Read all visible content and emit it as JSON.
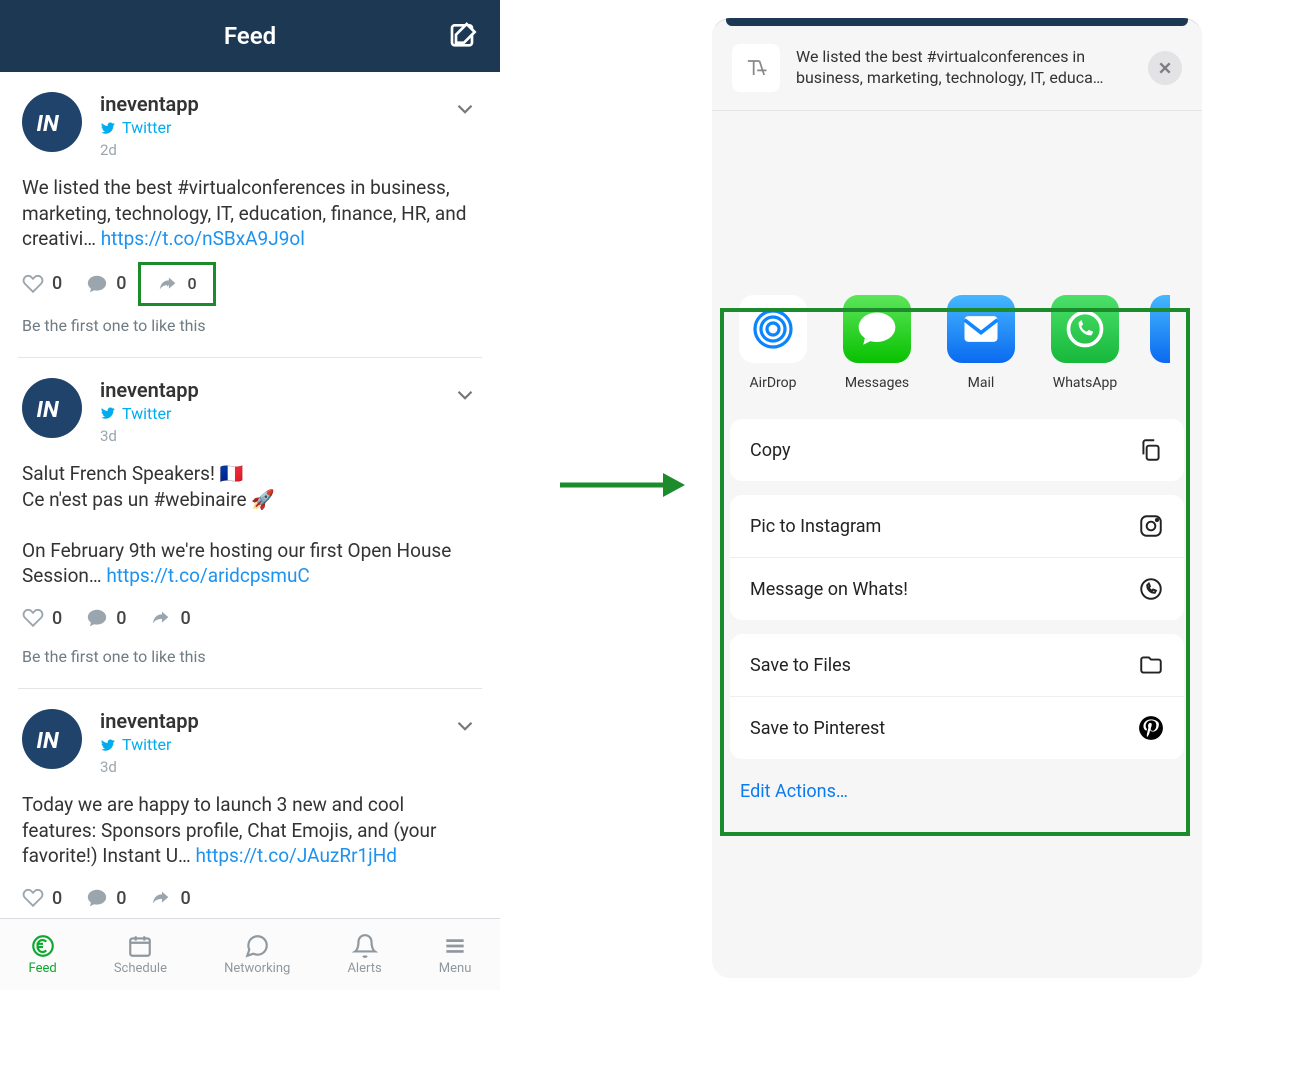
{
  "header": {
    "title": "Feed"
  },
  "posts": [
    {
      "username": "ineventapp",
      "source": "Twitter",
      "age": "2d",
      "body": "We listed the best #virtualconferences in business, marketing, technology, IT, education, finance, HR, and creativi… ",
      "link": "https://t.co/nSBxA9J9ol",
      "likes": "0",
      "comments": "0",
      "shares": "0",
      "like_note": "Be the first one to like this"
    },
    {
      "username": "ineventapp",
      "source": "Twitter",
      "age": "3d",
      "body_line1": "Salut French Speakers! 🇫🇷",
      "body_line2": "Ce n'est pas un #webinaire 🚀",
      "body_line3": "On February 9th we're hosting our first Open House Session… ",
      "link": "https://t.co/aridcpsmuC",
      "likes": "0",
      "comments": "0",
      "shares": "0",
      "like_note": "Be the first one to like this"
    },
    {
      "username": "ineventapp",
      "source": "Twitter",
      "age": "3d",
      "body": "Today we are happy to launch 3 new and cool features: Sponsors profile, Chat Emojis, and (your favorite!) Instant U… ",
      "link": "https://t.co/JAuzRr1jHd",
      "likes": "0",
      "comments": "0",
      "shares": "0"
    }
  ],
  "tabs": {
    "feed": "Feed",
    "schedule": "Schedule",
    "networking": "Networking",
    "alerts": "Alerts",
    "menu": "Menu"
  },
  "share": {
    "summary": "We listed the best #virtualconferences in business, marketing, technology, IT, educa…",
    "apps": {
      "airdrop": "AirDrop",
      "messages": "Messages",
      "mail": "Mail",
      "whatsapp": "WhatsApp"
    },
    "actions": {
      "copy": "Copy",
      "instagram": "Pic to Instagram",
      "whats": "Message on Whats!",
      "files": "Save to Files",
      "pinterest": "Save to Pinterest"
    },
    "edit": "Edit Actions…"
  },
  "colors": {
    "accent_green": "#1b8b2c",
    "header_bg": "#1c3852",
    "link": "#1d92ef"
  }
}
